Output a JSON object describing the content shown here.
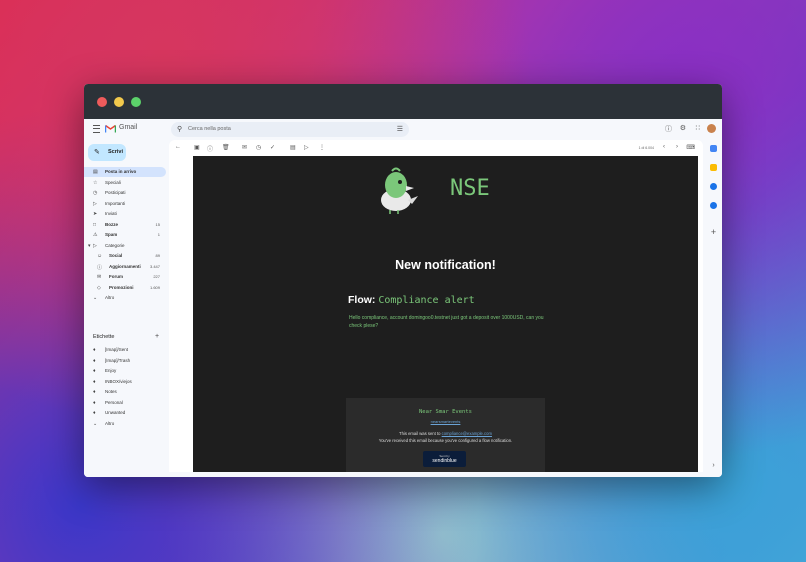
{
  "app": {
    "logo_text": "Gmail"
  },
  "search": {
    "placeholder": "Cerca nella posta"
  },
  "compose": {
    "label": "Scrivi"
  },
  "nav": [
    {
      "label": "Posta in arrivo",
      "count": "",
      "icon": "inbox-icon",
      "bold": true
    },
    {
      "label": "Speciali",
      "count": "",
      "icon": "star-icon"
    },
    {
      "label": "Posticipati",
      "count": "",
      "icon": "clock-icon"
    },
    {
      "label": "Importanti",
      "count": "",
      "icon": "important-icon"
    },
    {
      "label": "Inviati",
      "count": "",
      "icon": "send-icon"
    },
    {
      "label": "Bozze",
      "count": "15",
      "icon": "draft-icon",
      "bold": true
    },
    {
      "label": "Spam",
      "count": "1",
      "icon": "spam-icon",
      "bold": true
    },
    {
      "label": "Categorie",
      "count": "",
      "icon": "label-icon"
    },
    {
      "label": "Social",
      "count": "89",
      "icon": "people-icon",
      "bold": true
    },
    {
      "label": "Aggiornamenti",
      "count": "3.447",
      "icon": "info-icon",
      "bold": true
    },
    {
      "label": "Forum",
      "count": "227",
      "icon": "forum-icon",
      "bold": true
    },
    {
      "label": "Promozioni",
      "count": "1.609",
      "icon": "tag-icon",
      "bold": true
    },
    {
      "label": "Altro",
      "count": "",
      "icon": "chevron-down-icon"
    }
  ],
  "labels_section": {
    "title": "Etichette"
  },
  "labels": [
    "[Imap]/Sent",
    "[Imap]/Trash",
    "Enjoy",
    "INBOX/viejos",
    "Notes",
    "Personal",
    "Unwanted",
    "Altro"
  ],
  "pager": {
    "text": "1 di 6.004"
  },
  "email": {
    "brand": "NSE",
    "heading": "New notification!",
    "flow_label": "Flow:",
    "flow_name": "Compliance alert",
    "message": "Hello compliance, account domingoo0.testnet just got a deposit over 1000USD, can you check plese?",
    "footer_title": "Near Smar Events",
    "footer_link": "nearsmartevents",
    "sent_prefix": "This email was sent to",
    "sent_address": "compliance@example.com",
    "reason": "You've received this email because you've configured a flow notification.",
    "badge_small": "Sent by",
    "badge_name": "sendinblue"
  },
  "colors": {
    "accent_green": "#7bc77a",
    "email_bg": "#1e1e1e",
    "titlebar": "#2c3238",
    "active_nav": "#d3e3fd"
  }
}
